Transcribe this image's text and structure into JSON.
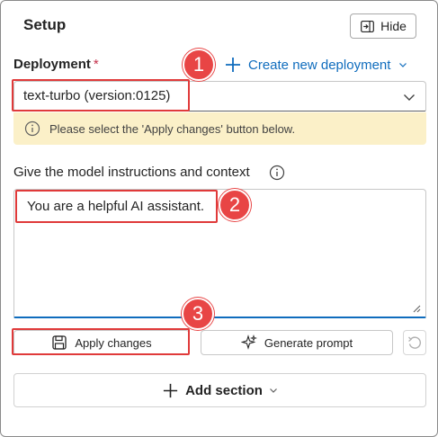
{
  "header": {
    "title": "Setup",
    "hide_label": "Hide",
    "hide_icon": "panel-collapse-icon"
  },
  "deployment": {
    "label": "Deployment",
    "required_marker": "*",
    "create_label": "Create new deployment",
    "selected_value": "text-turbo (version:0125)",
    "warning": "Please select the 'Apply changes' button below."
  },
  "instructions": {
    "label": "Give the model instructions and context",
    "value": "You are a helpful AI assistant."
  },
  "actions": {
    "apply_label": "Apply changes",
    "generate_label": "Generate prompt",
    "add_section_label": "Add section"
  },
  "annotations": {
    "badge_1": "1",
    "badge_2": "2",
    "badge_3": "3"
  },
  "colors": {
    "accent": "#0f6cbd",
    "warning_bg": "#fbf0c8",
    "annotation_red": "#e84545",
    "required_red": "#c4314b"
  }
}
